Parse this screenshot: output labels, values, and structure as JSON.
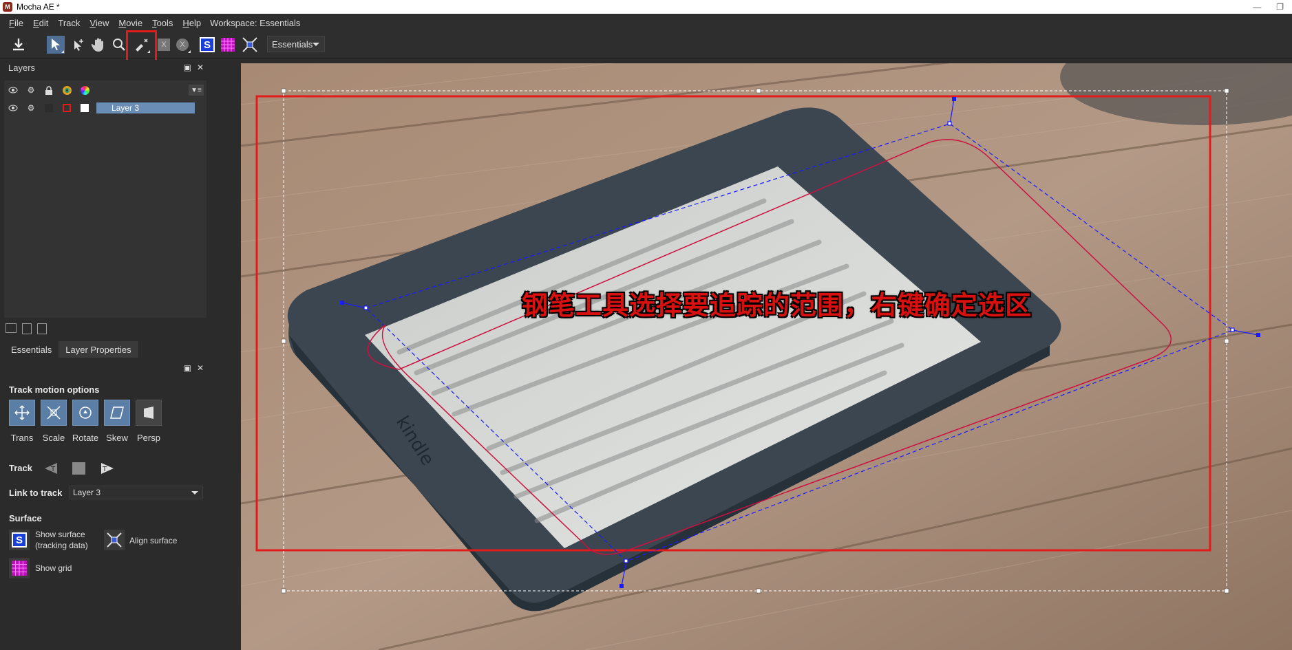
{
  "window": {
    "title": "Mocha AE *",
    "app_icon": "mocha-logo-icon",
    "controls": [
      "minimize-icon",
      "restore-icon"
    ]
  },
  "menu": {
    "items": [
      {
        "label": "File",
        "u": "F",
        "rest": "ile"
      },
      {
        "label": "Edit",
        "u": "E",
        "rest": "dit"
      },
      {
        "label": "Track",
        "u": "",
        "rest": "Track"
      },
      {
        "label": "View",
        "u": "V",
        "rest": "iew"
      },
      {
        "label": "Movie",
        "u": "M",
        "rest": "ovie"
      },
      {
        "label": "Tools",
        "u": "T",
        "rest": "ools"
      },
      {
        "label": "Help",
        "u": "H",
        "rest": "elp"
      }
    ],
    "workspace": "Workspace: Essentials"
  },
  "toolbar": {
    "tools": [
      "export-icon",
      "select-tool-icon",
      "select-points-icon",
      "hand-icon",
      "zoom-icon",
      "xspline-pen-icon",
      "bspline-icon",
      "magnetic-icon",
      "surface-icon",
      "grid-icon",
      "align-icon"
    ],
    "workspace_select": "Essentials"
  },
  "layers_panel": {
    "title": "Layers",
    "header_icons": [
      "visibility-icon",
      "cog-icon",
      "lock-icon",
      "color-wheel-icon",
      "matte-color-icon"
    ],
    "layers": [
      {
        "name": "Layer 3",
        "color": "#e21b1b",
        "selected": true
      }
    ]
  },
  "tabs": [
    "Essentials",
    "Layer Properties"
  ],
  "properties": {
    "track_motion_title": "Track motion options",
    "motion": [
      {
        "label": "Trans",
        "on": true
      },
      {
        "label": "Scale",
        "on": true
      },
      {
        "label": "Rotate",
        "on": true
      },
      {
        "label": "Skew",
        "on": true
      },
      {
        "label": "Persp",
        "on": false
      }
    ],
    "track_label": "Track",
    "link_label": "Link to track",
    "link_value": "Layer 3",
    "surface_title": "Surface",
    "show_surface": "Show surface",
    "tracking_data": "(tracking data)",
    "align_surface": "Align surface",
    "show_grid": "Show grid"
  },
  "viewer": {
    "annotation": "钢笔工具选择要追踪的范围，右键确定选区",
    "accent_red": "#e21b1b",
    "spline_color": "#cc1040",
    "control_color": "#1a1aff"
  }
}
